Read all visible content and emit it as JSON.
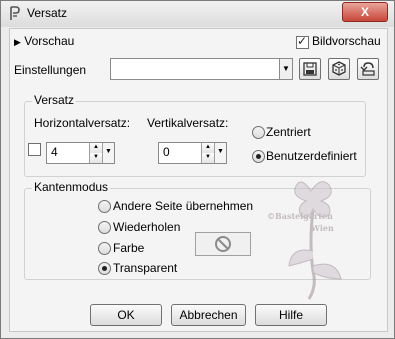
{
  "window": {
    "title": "Versatz",
    "close_label": "X"
  },
  "header": {
    "preview_label": "Vorschau",
    "bildvorschau_label": "Bildvorschau",
    "bildvorschau_checked": true,
    "settings_label": "Einstellungen",
    "settings_value": ""
  },
  "offset_group": {
    "title": "Versatz",
    "horizontal_label": "Horizontalversatz:",
    "vertical_label": "Vertikalversatz:",
    "horizontal_value": "4",
    "vertical_value": "0",
    "link_checked": false,
    "options": [
      {
        "label": "Zentriert",
        "selected": false
      },
      {
        "label": "Benutzerdefiniert",
        "selected": true
      }
    ]
  },
  "edge_group": {
    "title": "Kantenmodus",
    "options": [
      {
        "label": "Andere Seite übernehmen",
        "selected": false
      },
      {
        "label": "Wiederholen",
        "selected": false
      },
      {
        "label": "Farbe",
        "selected": false
      },
      {
        "label": "Transparent",
        "selected": true
      }
    ],
    "color_swatch_icon": "no-symbol-icon"
  },
  "buttons": {
    "ok": "OK",
    "cancel": "Abbrechen",
    "help": "Hilfe"
  },
  "watermark": {
    "line1": "©Bastelgarten",
    "line2": "Wien"
  },
  "colors": {
    "window_bg": "#ececec",
    "panel_bg": "#f4f4f4",
    "close_red": "#c9463a"
  }
}
